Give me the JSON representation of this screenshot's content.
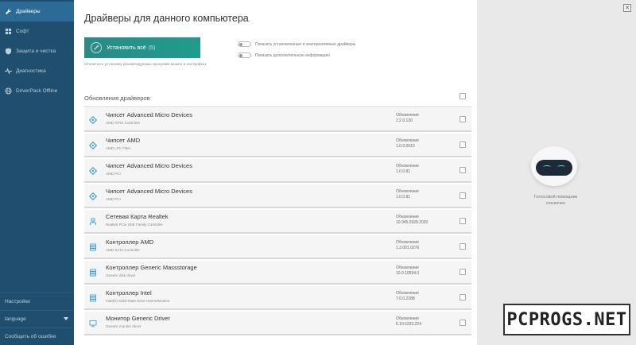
{
  "sidebar": {
    "items": [
      {
        "label": "Драйверы",
        "icon": "wrench-icon",
        "active": true
      },
      {
        "label": "Софт",
        "icon": "grid-icon",
        "active": false
      },
      {
        "label": "Защита и чистка",
        "icon": "shield-icon",
        "active": false
      },
      {
        "label": "Диагностика",
        "icon": "pulse-icon",
        "active": false
      },
      {
        "label": "DriverPack Offline",
        "icon": "globe-icon",
        "active": false
      }
    ],
    "bottom": {
      "settings": "Настройки",
      "language": "language",
      "report": "Сообщить об ошибке"
    }
  },
  "main": {
    "title": "Драйверы для данного компьютера",
    "install_button": {
      "label": "Установить всё",
      "count": "(5)"
    },
    "note": "Отключить установку рекомендуемых программ можно в настройках",
    "toggles": [
      "Показать установленные и альтернативные драйверы",
      "Показать дополнительную информацию"
    ],
    "section_title": "Обновления драйверов",
    "update_label": "Обновление",
    "drivers": [
      {
        "name": "Чипсет Advanced Micro Devices",
        "sub": "AMD GPIO Controller",
        "version": "2.2.0.130",
        "icon": "chipset-icon"
      },
      {
        "name": "Чипсет AMD",
        "sub": "AMD LPC Filter",
        "version": "1.0.0.0010",
        "icon": "chipset-icon"
      },
      {
        "name": "Чипсет Advanced Micro Devices",
        "sub": "AMD PCI",
        "version": "1.0.0.81",
        "icon": "chipset-icon"
      },
      {
        "name": "Чипсет Advanced Micro Devices",
        "sub": "AMD PCI",
        "version": "1.0.0.81",
        "icon": "chipset-icon"
      },
      {
        "name": "Сетевая Карта Realtek",
        "sub": "Realtek PCIe GbE Family Controller",
        "version": "10.045.0928.2020",
        "icon": "network-icon"
      },
      {
        "name": "Контроллер AMD",
        "sub": "AMD SATA Controller",
        "version": "1.3.001.0276",
        "icon": "storage-icon"
      },
      {
        "name": "Контроллер Generic Massstorage",
        "sub": "Generic disk driver",
        "version": "10.0.10594.0",
        "icon": "storage-icon"
      },
      {
        "name": "Контроллер Intel",
        "sub": "Intel(R) Solid-State Drive Hamm/Monitor",
        "version": "7.0.0.2288",
        "icon": "storage-icon"
      },
      {
        "name": "Монитор Generic Driver",
        "sub": "Generic monitor driver",
        "version": "6.10.6233.224",
        "icon": "monitor-icon"
      }
    ]
  },
  "assistant": {
    "caption_line1": "Голосовой помощник",
    "caption_line2": "отключен"
  },
  "watermark": "PCPROGS.NET",
  "colors": {
    "sidebar_bg": "#1f4e6e",
    "sidebar_active": "#2b6b96",
    "accent": "#1f9c8c",
    "icon_blue": "#4a9fd6"
  }
}
